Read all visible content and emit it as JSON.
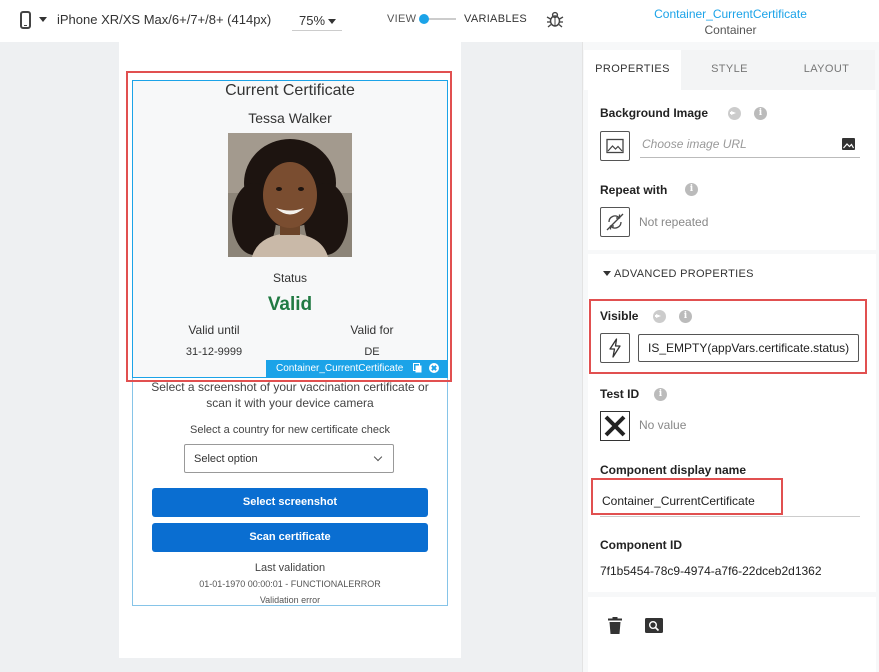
{
  "toolbar": {
    "device_label": "iPhone XR/XS Max/6+/7+/8+ (414px)",
    "zoom_label": "75%",
    "view_label": "VIEW",
    "variables_label": "VARIABLES",
    "toggle_color": "#1ba3e8"
  },
  "canvas": {
    "certificate": {
      "title": "Current Certificate",
      "name": "Tessa Walker",
      "status_label": "Status",
      "status_value": "Valid",
      "status_color": "#217a43",
      "valid_until_label": "Valid until",
      "valid_until_value": "31-12-9999",
      "valid_for_label": "Valid for",
      "valid_for_value": "DE"
    },
    "container_tag": "Container_CurrentCertificate",
    "instructions": "Select a screenshot of your vaccination certificate or scan it with your device camera",
    "country_label": "Select a country for new certificate check",
    "select_placeholder": "Select option",
    "buttons": {
      "screenshot": "Select screenshot",
      "scan": "Scan certificate"
    },
    "button_color": "#0a6ed1",
    "last_validation_label": "Last validation",
    "last_validation_value": "01-01-1970 00:00:01 - FUNCTIONALERROR",
    "validation_error": "Validation error",
    "highlight_color": "#e15050"
  },
  "panel": {
    "component_name": "Container_CurrentCertificate",
    "component_type": "Container",
    "tabs": [
      "PROPERTIES",
      "STYLE",
      "LAYOUT"
    ],
    "active_tab": "PROPERTIES",
    "background_image": {
      "title": "Background Image",
      "placeholder": "Choose image URL"
    },
    "repeat_with": {
      "title": "Repeat with",
      "value": "Not repeated"
    },
    "advanced_label": "ADVANCED PROPERTIES",
    "visible": {
      "title": "Visible",
      "formula": "IS_EMPTY(appVars.certificate.status)"
    },
    "test_id": {
      "title": "Test ID",
      "value": "No value"
    },
    "display_name": {
      "title": "Component display name",
      "value": "Container_CurrentCertificate"
    },
    "component_id": {
      "title": "Component ID",
      "value": "7f1b5454-78c9-4974-a7f6-22dceb2d1362"
    },
    "info_glyph": "i"
  }
}
